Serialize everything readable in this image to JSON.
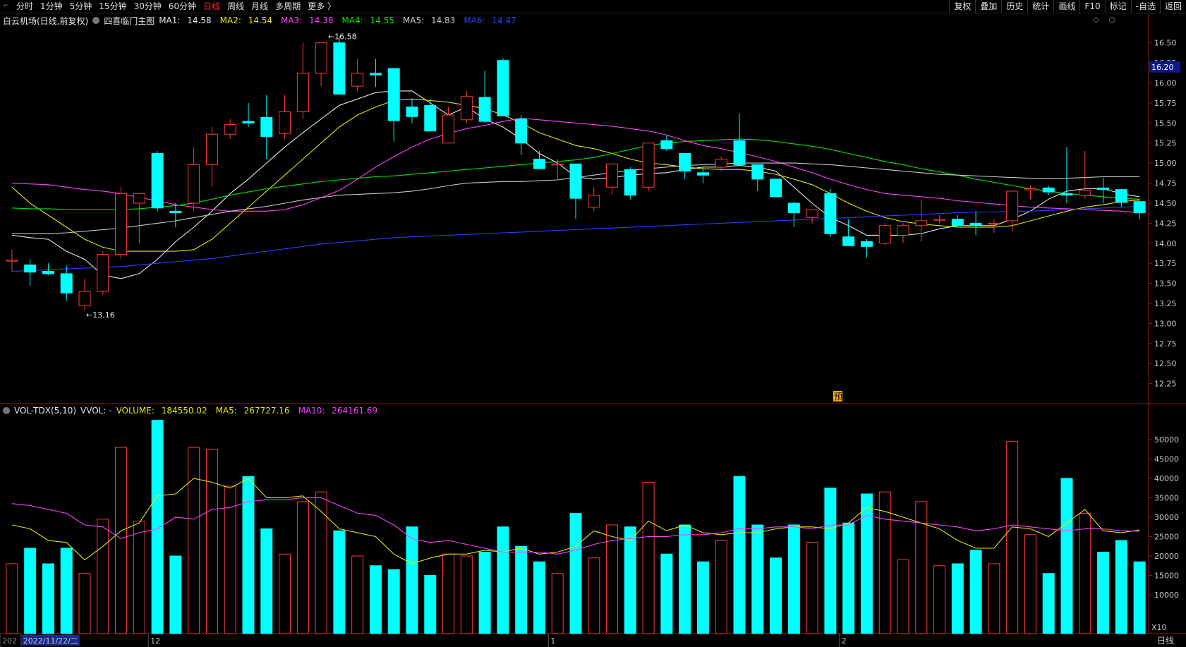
{
  "toolbar": {
    "corner": "⌐",
    "periods": [
      "分时",
      "1分钟",
      "5分钟",
      "15分钟",
      "30分钟",
      "60分钟",
      "日线",
      "周线",
      "月线",
      "多周期",
      "更多 〉"
    ],
    "active_index": 6,
    "right": [
      "复权",
      "叠加",
      "历史",
      "统计",
      "画线",
      "F10",
      "标记",
      "-自选",
      "返回"
    ]
  },
  "price_panel": {
    "stock": "白云机场(日线,前复权)",
    "template": "四喜临门主图",
    "ma": [
      {
        "label": "MA1:",
        "value": "14.58",
        "color": "#e6e6e6"
      },
      {
        "label": "MA2:",
        "value": "14.54",
        "color": "#e6e600"
      },
      {
        "label": "MA3:",
        "value": "14.38",
        "color": "#ff40ff"
      },
      {
        "label": "MA4:",
        "value": "14.55",
        "color": "#00e600"
      },
      {
        "label": "MA5:",
        "value": "14.83",
        "color": "#c8c8c8"
      },
      {
        "label": "MA6:",
        "value": "14.47",
        "color": "#2a40ff"
      }
    ],
    "axis_ticks": [
      "16.50",
      "16.25",
      "16.00",
      "15.75",
      "15.50",
      "15.25",
      "15.00",
      "14.75",
      "14.50",
      "14.25",
      "14.00",
      "13.75",
      "13.50",
      "13.25",
      "13.00",
      "12.75",
      "12.50",
      "12.25"
    ],
    "current_price_tag": "16.20",
    "high_annotation": "16.58",
    "low_annotation": "13.16",
    "marker": "预",
    "icons": [
      "◇",
      "○"
    ]
  },
  "volume_panel": {
    "title": "VOL-TDX(5,10)",
    "vvol": "VVOL: -",
    "volume": {
      "label": "VOLUME:",
      "value": "184550.02"
    },
    "ma5": {
      "label": "MA5:",
      "value": "267727.16"
    },
    "ma10": {
      "label": "MA10:",
      "value": "264161.69"
    },
    "axis_ticks": [
      "50000",
      "45000",
      "40000",
      "35000",
      "30000",
      "25000",
      "20000",
      "15000",
      "10000"
    ],
    "unit": "X10"
  },
  "date_axis": {
    "labels": [
      "202",
      "2022/11/22/二",
      "12",
      "1",
      "2"
    ],
    "period": "日线"
  },
  "colors": {
    "up": "#ff3c3c",
    "down": "#00ffff",
    "ma1": "#e6e6e6",
    "ma2": "#e6e600",
    "ma3": "#ff40ff",
    "ma4": "#00e600",
    "ma5": "#c8c8c8",
    "ma6": "#2a40ff",
    "grid_border": "#8b1a1a"
  },
  "chart_data": {
    "type": "candlestick",
    "candles": [
      {
        "o": 13.79,
        "h": 13.92,
        "l": 13.65,
        "c": 13.79
      },
      {
        "o": 13.73,
        "h": 13.8,
        "l": 13.47,
        "c": 13.64
      },
      {
        "o": 13.65,
        "h": 13.75,
        "l": 13.6,
        "c": 13.62
      },
      {
        "o": 13.62,
        "h": 13.72,
        "l": 13.28,
        "c": 13.38
      },
      {
        "o": 13.22,
        "h": 13.56,
        "l": 13.16,
        "c": 13.4
      },
      {
        "o": 13.4,
        "h": 13.9,
        "l": 13.36,
        "c": 13.86
      },
      {
        "o": 13.86,
        "h": 14.7,
        "l": 13.8,
        "c": 14.62
      },
      {
        "o": 14.5,
        "h": 14.6,
        "l": 14.0,
        "c": 14.62
      },
      {
        "o": 15.12,
        "h": 15.15,
        "l": 14.4,
        "c": 14.44
      },
      {
        "o": 14.4,
        "h": 14.5,
        "l": 14.2,
        "c": 14.38
      },
      {
        "o": 14.5,
        "h": 15.2,
        "l": 14.4,
        "c": 14.98
      },
      {
        "o": 14.98,
        "h": 15.45,
        "l": 14.7,
        "c": 15.36
      },
      {
        "o": 15.36,
        "h": 15.55,
        "l": 15.3,
        "c": 15.48
      },
      {
        "o": 15.52,
        "h": 15.75,
        "l": 15.45,
        "c": 15.5
      },
      {
        "o": 15.57,
        "h": 15.85,
        "l": 15.05,
        "c": 15.33
      },
      {
        "o": 15.37,
        "h": 15.85,
        "l": 15.3,
        "c": 15.64
      },
      {
        "o": 15.64,
        "h": 16.5,
        "l": 15.55,
        "c": 16.12
      },
      {
        "o": 16.12,
        "h": 16.42,
        "l": 15.96,
        "c": 16.5
      },
      {
        "o": 16.5,
        "h": 16.58,
        "l": 15.85,
        "c": 15.86
      },
      {
        "o": 15.96,
        "h": 16.3,
        "l": 15.9,
        "c": 16.12
      },
      {
        "o": 16.12,
        "h": 16.3,
        "l": 15.95,
        "c": 16.1
      },
      {
        "o": 16.18,
        "h": 16.18,
        "l": 15.27,
        "c": 15.53
      },
      {
        "o": 15.7,
        "h": 15.8,
        "l": 15.5,
        "c": 15.58
      },
      {
        "o": 15.72,
        "h": 15.8,
        "l": 15.4,
        "c": 15.4
      },
      {
        "o": 15.25,
        "h": 15.7,
        "l": 15.25,
        "c": 15.6
      },
      {
        "o": 15.54,
        "h": 15.9,
        "l": 15.5,
        "c": 15.83
      },
      {
        "o": 15.82,
        "h": 16.15,
        "l": 15.5,
        "c": 15.52
      },
      {
        "o": 16.28,
        "h": 16.31,
        "l": 15.59,
        "c": 15.59
      },
      {
        "o": 15.55,
        "h": 15.6,
        "l": 15.1,
        "c": 15.25
      },
      {
        "o": 15.05,
        "h": 15.15,
        "l": 14.93,
        "c": 14.93
      },
      {
        "o": 14.98,
        "h": 15.05,
        "l": 14.8,
        "c": 14.99
      },
      {
        "o": 14.99,
        "h": 14.99,
        "l": 14.3,
        "c": 14.56
      },
      {
        "o": 14.45,
        "h": 14.7,
        "l": 14.4,
        "c": 14.6
      },
      {
        "o": 14.7,
        "h": 14.99,
        "l": 14.6,
        "c": 14.99
      },
      {
        "o": 14.92,
        "h": 14.95,
        "l": 14.55,
        "c": 14.6
      },
      {
        "o": 14.7,
        "h": 15.25,
        "l": 14.65,
        "c": 15.25
      },
      {
        "o": 15.28,
        "h": 15.35,
        "l": 15.15,
        "c": 15.18
      },
      {
        "o": 15.12,
        "h": 15.12,
        "l": 14.8,
        "c": 14.9
      },
      {
        "o": 14.88,
        "h": 14.95,
        "l": 14.75,
        "c": 14.85
      },
      {
        "o": 14.95,
        "h": 15.08,
        "l": 14.9,
        "c": 15.05
      },
      {
        "o": 15.28,
        "h": 15.62,
        "l": 14.98,
        "c": 14.98
      },
      {
        "o": 14.98,
        "h": 14.98,
        "l": 14.65,
        "c": 14.8
      },
      {
        "o": 14.8,
        "h": 14.8,
        "l": 14.58,
        "c": 14.58
      },
      {
        "o": 14.5,
        "h": 14.52,
        "l": 14.2,
        "c": 14.38
      },
      {
        "o": 14.32,
        "h": 14.4,
        "l": 14.25,
        "c": 14.42
      },
      {
        "o": 14.62,
        "h": 14.68,
        "l": 14.08,
        "c": 14.12
      },
      {
        "o": 14.08,
        "h": 14.3,
        "l": 13.98,
        "c": 13.97
      },
      {
        "o": 14.02,
        "h": 14.05,
        "l": 13.82,
        "c": 13.96
      },
      {
        "o": 14.0,
        "h": 14.25,
        "l": 13.98,
        "c": 14.22
      },
      {
        "o": 14.1,
        "h": 14.25,
        "l": 14.0,
        "c": 14.22
      },
      {
        "o": 14.22,
        "h": 14.55,
        "l": 14.02,
        "c": 14.28
      },
      {
        "o": 14.3,
        "h": 14.35,
        "l": 14.25,
        "c": 14.3
      },
      {
        "o": 14.3,
        "h": 14.35,
        "l": 14.2,
        "c": 14.22
      },
      {
        "o": 14.25,
        "h": 14.4,
        "l": 14.1,
        "c": 14.22
      },
      {
        "o": 14.25,
        "h": 14.3,
        "l": 14.13,
        "c": 14.25
      },
      {
        "o": 14.28,
        "h": 14.65,
        "l": 14.15,
        "c": 14.65
      },
      {
        "o": 14.68,
        "h": 14.72,
        "l": 14.55,
        "c": 14.68
      },
      {
        "o": 14.69,
        "h": 14.72,
        "l": 14.6,
        "c": 14.64
      },
      {
        "o": 14.62,
        "h": 15.2,
        "l": 14.5,
        "c": 14.6
      },
      {
        "o": 14.6,
        "h": 15.15,
        "l": 14.55,
        "c": 14.66
      },
      {
        "o": 14.69,
        "h": 14.82,
        "l": 14.5,
        "c": 14.67
      },
      {
        "o": 14.67,
        "h": 14.68,
        "l": 14.45,
        "c": 14.51
      },
      {
        "o": 14.52,
        "h": 14.55,
        "l": 14.3,
        "c": 14.38
      }
    ],
    "ma_lines": {
      "ma1": [
        14.1,
        14.07,
        14.05,
        13.9,
        13.8,
        13.6,
        13.56,
        13.62,
        13.8,
        14.02,
        14.2,
        14.4,
        14.62,
        14.8,
        15.0,
        15.2,
        15.38,
        15.55,
        15.72,
        15.8,
        15.88,
        15.9,
        15.9,
        15.75,
        15.6,
        15.7,
        15.55,
        15.45,
        15.3,
        15.12,
        15.0,
        14.83,
        14.8,
        14.82,
        14.85,
        14.87,
        14.88,
        14.92,
        14.95,
        14.95,
        14.97,
        14.95,
        14.9,
        14.7,
        14.5,
        14.32,
        14.22,
        14.1,
        14.1,
        14.1,
        14.12,
        14.18,
        14.22,
        14.22,
        14.22,
        14.3,
        14.4,
        14.55,
        14.65,
        14.68,
        14.68,
        14.62,
        14.58
      ],
      "ma2": [
        14.7,
        14.5,
        14.35,
        14.2,
        14.05,
        13.95,
        13.9,
        13.9,
        13.9,
        13.9,
        13.92,
        14.05,
        14.25,
        14.45,
        14.65,
        14.85,
        15.05,
        15.25,
        15.45,
        15.6,
        15.7,
        15.78,
        15.8,
        15.78,
        15.76,
        15.72,
        15.68,
        15.6,
        15.5,
        15.38,
        15.3,
        15.22,
        15.18,
        15.12,
        15.05,
        15.0,
        14.98,
        14.95,
        14.93,
        14.92,
        14.92,
        14.9,
        14.86,
        14.8,
        14.73,
        14.62,
        14.5,
        14.4,
        14.32,
        14.27,
        14.24,
        14.22,
        14.2,
        14.2,
        14.2,
        14.22,
        14.28,
        14.34,
        14.4,
        14.45,
        14.48,
        14.52,
        14.54
      ],
      "ma3": [
        14.75,
        14.74,
        14.73,
        14.7,
        14.67,
        14.65,
        14.62,
        14.57,
        14.53,
        14.48,
        14.45,
        14.42,
        14.4,
        14.4,
        14.4,
        14.42,
        14.48,
        14.57,
        14.66,
        14.8,
        14.95,
        15.08,
        15.2,
        15.3,
        15.37,
        15.43,
        15.47,
        15.52,
        15.56,
        15.54,
        15.52,
        15.5,
        15.48,
        15.46,
        15.43,
        15.4,
        15.35,
        15.28,
        15.22,
        15.18,
        15.13,
        15.08,
        15.02,
        14.95,
        14.88,
        14.8,
        14.73,
        14.67,
        14.62,
        14.6,
        14.58,
        14.56,
        14.53,
        14.51,
        14.49,
        14.47,
        14.45,
        14.44,
        14.43,
        14.42,
        14.41,
        14.4,
        14.38
      ],
      "ma4": [
        14.44,
        14.43,
        14.43,
        14.42,
        14.42,
        14.42,
        14.42,
        14.43,
        14.45,
        14.47,
        14.5,
        14.55,
        14.6,
        14.64,
        14.68,
        14.71,
        14.74,
        14.77,
        14.79,
        14.81,
        14.83,
        14.84,
        14.86,
        14.88,
        14.9,
        14.92,
        14.94,
        14.96,
        14.98,
        15.0,
        15.02,
        15.04,
        15.07,
        15.12,
        15.17,
        15.22,
        15.25,
        15.27,
        15.28,
        15.29,
        15.3,
        15.29,
        15.27,
        15.24,
        15.21,
        15.17,
        15.12,
        15.07,
        15.02,
        14.98,
        14.93,
        14.89,
        14.85,
        14.8,
        14.76,
        14.72,
        14.68,
        14.65,
        14.62,
        14.6,
        14.58,
        14.56,
        14.55
      ],
      "ma5": [
        14.12,
        14.12,
        14.12,
        14.13,
        14.15,
        14.17,
        14.19,
        14.22,
        14.25,
        14.28,
        14.32,
        14.36,
        14.4,
        14.43,
        14.46,
        14.5,
        14.54,
        14.57,
        14.6,
        14.61,
        14.62,
        14.63,
        14.65,
        14.68,
        14.72,
        14.75,
        14.76,
        14.77,
        14.77,
        14.78,
        14.79,
        14.82,
        14.85,
        14.88,
        14.91,
        14.93,
        14.95,
        14.97,
        14.98,
        14.99,
        15.0,
        15.0,
        15.0,
        15.0,
        14.99,
        14.98,
        14.96,
        14.94,
        14.92,
        14.9,
        14.88,
        14.86,
        14.85,
        14.84,
        14.83,
        14.82,
        14.81,
        14.81,
        14.81,
        14.82,
        14.83,
        14.83,
        14.83
      ],
      "ma6": [
        13.65,
        13.66,
        13.67,
        13.68,
        13.69,
        13.7,
        13.71,
        13.73,
        13.75,
        13.77,
        13.79,
        13.81,
        13.84,
        13.87,
        13.9,
        13.93,
        13.96,
        13.99,
        14.01,
        14.03,
        14.05,
        14.07,
        14.08,
        14.09,
        14.1,
        14.11,
        14.12,
        14.13,
        14.14,
        14.15,
        14.16,
        14.17,
        14.18,
        14.19,
        14.2,
        14.21,
        14.22,
        14.23,
        14.24,
        14.25,
        14.26,
        14.27,
        14.28,
        14.29,
        14.3,
        14.31,
        14.32,
        14.33,
        14.34,
        14.35,
        14.36,
        14.37,
        14.38,
        14.39,
        14.39,
        14.4,
        14.4,
        14.41,
        14.42,
        14.43,
        14.44,
        14.45,
        14.46
      ]
    },
    "volume": {
      "values": [
        18000,
        22000,
        18000,
        22000,
        15500,
        29500,
        48000,
        29000,
        55000,
        20000,
        48000,
        47500,
        38000,
        40500,
        27000,
        20500,
        34000,
        36500,
        26500,
        20000,
        17500,
        16500,
        27500,
        15000,
        20500,
        20000,
        21000,
        27500,
        22500,
        18500,
        15500,
        31000,
        19500,
        28000,
        27500,
        39000,
        20500,
        28000,
        18500,
        24000,
        40500,
        28000,
        19500,
        28000,
        23500,
        37500,
        28500,
        36000,
        36500,
        19000,
        34000,
        17500,
        18000,
        21500,
        18000,
        49500,
        25500,
        15500,
        40000,
        31000,
        21000,
        24000,
        18500
      ],
      "ma5": [
        28000,
        27000,
        24000,
        23500,
        19000,
        22500,
        26500,
        28500,
        35500,
        36000,
        40000,
        39000,
        37500,
        40000,
        35000,
        35000,
        35500,
        31500,
        27000,
        26000,
        25000,
        20500,
        18000,
        19500,
        20500,
        20500,
        21500,
        21000,
        22000,
        20500,
        21000,
        22500,
        26500,
        25000,
        24000,
        29000,
        26500,
        28000,
        26000,
        25500,
        26000,
        26000,
        27000,
        27500,
        27500,
        27000,
        28500,
        32500,
        31500,
        30000,
        28500,
        27000,
        24000,
        22000,
        22000,
        27500,
        27000,
        25000,
        28500,
        32000,
        26500,
        26000,
        26700
      ],
      "ma10": [
        33500,
        33000,
        32000,
        31000,
        28000,
        27500,
        24500,
        26000,
        27000,
        30000,
        29500,
        32000,
        32500,
        34000,
        34500,
        34500,
        35000,
        35000,
        33000,
        31000,
        30500,
        28000,
        24500,
        23500,
        24000,
        23000,
        22000,
        21000,
        21000,
        21000,
        20500,
        21500,
        23000,
        24000,
        24500,
        25000,
        25000,
        25500,
        25500,
        26000,
        27000,
        27000,
        27500,
        27500,
        27000,
        28000,
        28000,
        30500,
        29500,
        29000,
        28500,
        28000,
        27500,
        26500,
        27000,
        28000,
        27500,
        27000,
        26500,
        27000,
        27000,
        26500,
        26400
      ]
    }
  }
}
